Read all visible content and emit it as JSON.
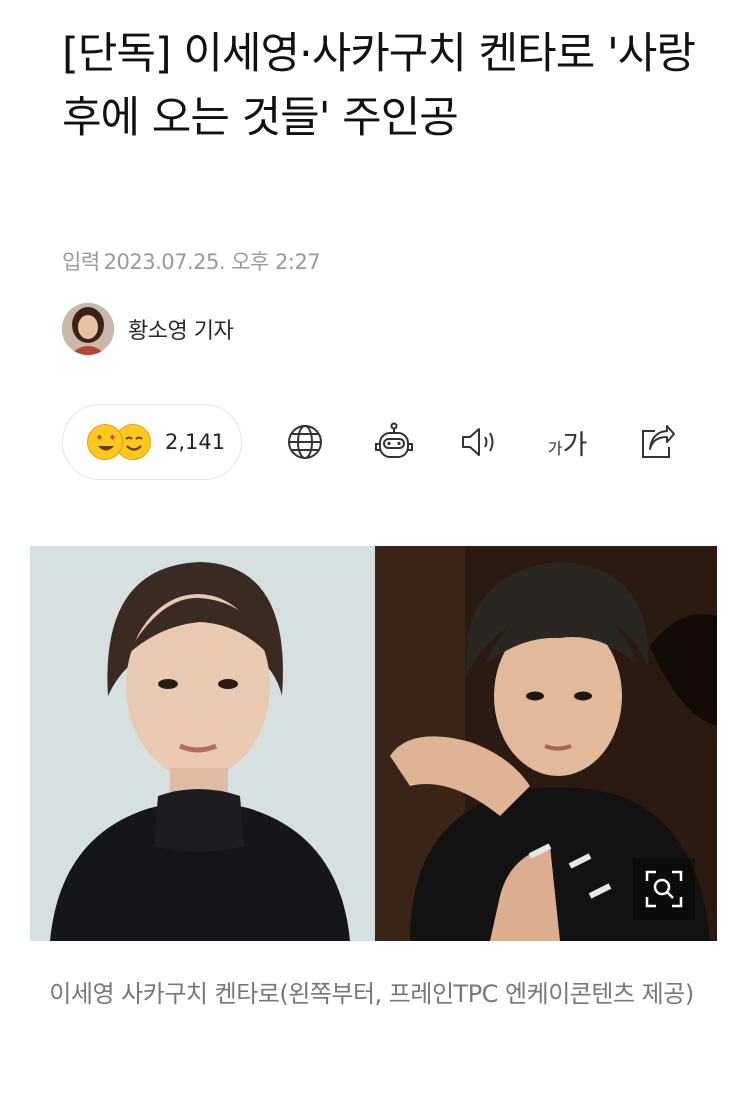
{
  "article": {
    "headline": "[단독] 이세영·사카구치 켄타로 '사랑 후에 오는 것들' 주인공",
    "meta_label": "입력",
    "meta_time": "2023.07.25. 오후 2:27",
    "author": "황소영 기자"
  },
  "toolbar": {
    "reaction_count": "2,141",
    "text_size_small": "가",
    "text_size_large": "가",
    "icons": [
      "emoji-love-face",
      "emoji-smile-face",
      "globe-icon",
      "robot-icon",
      "speaker-icon",
      "text-size-icon",
      "share-icon"
    ]
  },
  "photo": {
    "caption": "이세영 사카구치 켄타로(왼쪽부터, 프레인TPC 엔케이콘텐츠 제공)",
    "zoom_icon": "zoom-icon"
  },
  "colors": {
    "emoji": "#ffc820",
    "meta_text": "#9a9a9a",
    "caption_text": "#777777"
  }
}
